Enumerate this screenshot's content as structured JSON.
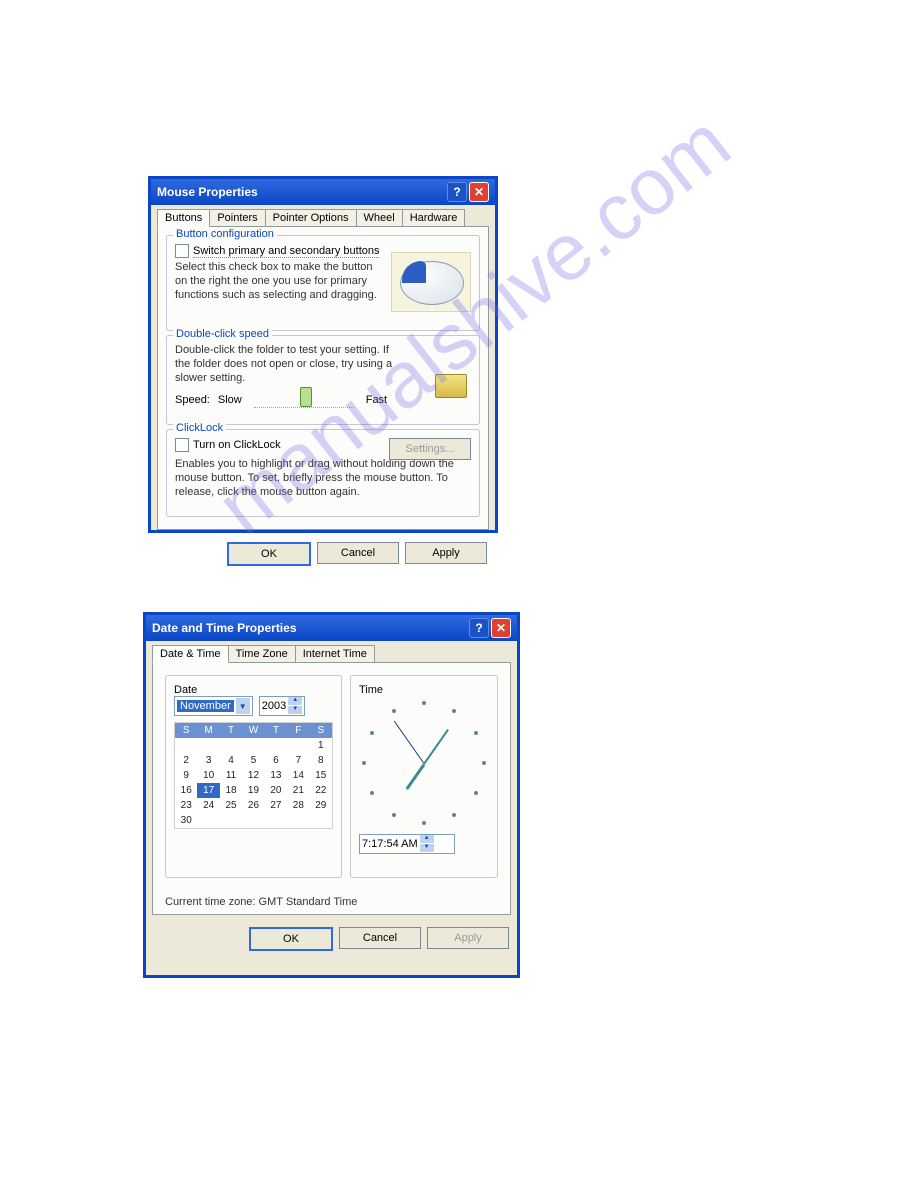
{
  "watermark": "manualshive.com",
  "mouse_dialog": {
    "title": "Mouse Properties",
    "tabs": [
      "Buttons",
      "Pointers",
      "Pointer Options",
      "Wheel",
      "Hardware"
    ],
    "active_tab": 0,
    "button_config": {
      "legend": "Button configuration",
      "checkbox_label": "Switch primary and secondary buttons",
      "desc": "Select this check box to make the button on the right the one you use for primary functions such as selecting and dragging."
    },
    "double_click": {
      "legend": "Double-click speed",
      "desc": "Double-click the folder to test your setting. If the folder does not open or close, try using a slower setting.",
      "speed_label": "Speed:",
      "slow_label": "Slow",
      "fast_label": "Fast"
    },
    "clicklock": {
      "legend": "ClickLock",
      "checkbox_label": "Turn on ClickLock",
      "settings_button": "Settings...",
      "desc": "Enables you to highlight or drag without holding down the mouse button. To set, briefly press the mouse button. To release, click the mouse button again."
    },
    "buttons": {
      "ok": "OK",
      "cancel": "Cancel",
      "apply": "Apply"
    }
  },
  "datetime_dialog": {
    "title": "Date and Time Properties",
    "tabs": [
      "Date & Time",
      "Time Zone",
      "Internet Time"
    ],
    "active_tab": 0,
    "date_legend": "Date",
    "time_legend": "Time",
    "month": "November",
    "year": "2003",
    "weekdays": [
      "S",
      "M",
      "T",
      "W",
      "T",
      "F",
      "S"
    ],
    "days": [
      "",
      "",
      "",
      "",
      "",
      "",
      "1",
      "2",
      "3",
      "4",
      "5",
      "6",
      "7",
      "8",
      "9",
      "10",
      "11",
      "12",
      "13",
      "14",
      "15",
      "16",
      "17",
      "18",
      "19",
      "20",
      "21",
      "22",
      "23",
      "24",
      "25",
      "26",
      "27",
      "28",
      "29",
      "30",
      "",
      "",
      "",
      "",
      "",
      ""
    ],
    "selected_day": "17",
    "time_value": "7:17:54 AM",
    "tz_line": "Current time zone:  GMT Standard Time",
    "buttons": {
      "ok": "OK",
      "cancel": "Cancel",
      "apply": "Apply"
    }
  }
}
